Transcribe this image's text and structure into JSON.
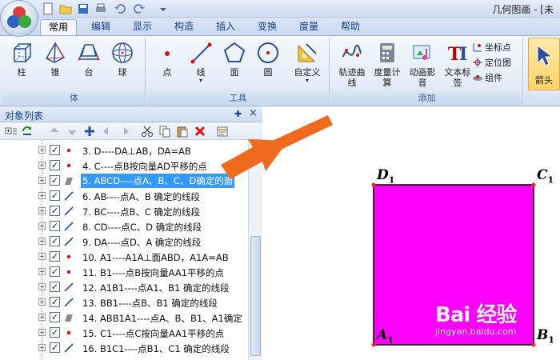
{
  "window": {
    "title": "几何图画 - [未"
  },
  "colors": {
    "ribbon_bg": "#e3ecf8",
    "selection": "#3399ff",
    "face_fill": "#ff00ff",
    "vertex": "#ff0000",
    "arrow": "#f07020"
  },
  "tabs": [
    "常用",
    "编辑",
    "显示",
    "构造",
    "插入",
    "变换",
    "度量",
    "帮助"
  ],
  "ribbon": {
    "groups": {
      "solid": {
        "label": "体",
        "buttons": [
          "柱",
          "锥",
          "台",
          "球"
        ]
      },
      "tools": {
        "label": "工具",
        "buttons": [
          "点",
          "线",
          "面",
          "圆",
          "自定义"
        ]
      },
      "add": {
        "label": "添加",
        "buttons": [
          "轨迹曲线",
          "度量计算",
          "动画影音",
          "文本标签"
        ],
        "small": [
          "坐标点",
          "定位图",
          "组件"
        ]
      }
    },
    "arrow_label": "箭头"
  },
  "panel": {
    "title": "对象列表",
    "pin": "ᵖ",
    "close": "×",
    "items": [
      {
        "text": "3. D----DA⊥AB，DA=AB",
        "icon": "point-icon"
      },
      {
        "text": "4. C----点B按向量AD平移的点",
        "icon": "point-icon"
      },
      {
        "text": "5. ABCD----点A、B、C、D确定的面",
        "icon": "face-icon",
        "selected": true
      },
      {
        "text": "6. AB----点A、B 确定的线段",
        "icon": "segment-icon"
      },
      {
        "text": "7. BC----点B、C 确定的线段",
        "icon": "segment-icon"
      },
      {
        "text": "8. CD----点C、D 确定的线段",
        "icon": "segment-icon"
      },
      {
        "text": "9. DA----点D、A 确定的线段",
        "icon": "segment-icon"
      },
      {
        "text": "10. A1----A1A⊥面ABD，A1A=AB",
        "icon": "point-icon"
      },
      {
        "text": "11. B1----点B按向量AA1平移的点",
        "icon": "point-icon"
      },
      {
        "text": "12. A1B1----点A1、B1 确定的线段",
        "icon": "segment-icon"
      },
      {
        "text": "13. BB1----点B、B1 确定的线段",
        "icon": "segment-icon"
      },
      {
        "text": "14. ABB1A1----点A、B、B1、A1确定",
        "icon": "face-icon"
      },
      {
        "text": "15. C1----点C按向量AA1平移的点",
        "icon": "point-icon"
      },
      {
        "text": "16. B1C1----点B1、C1 确定的线段",
        "icon": "segment-icon"
      }
    ]
  },
  "canvas": {
    "labels": {
      "D1": "D",
      "C1": "C",
      "A1": "A",
      "B1": "B",
      "sub": "1"
    },
    "watermark": {
      "logo": "Bai 经验",
      "url": "jingyan.baidu.com"
    }
  }
}
